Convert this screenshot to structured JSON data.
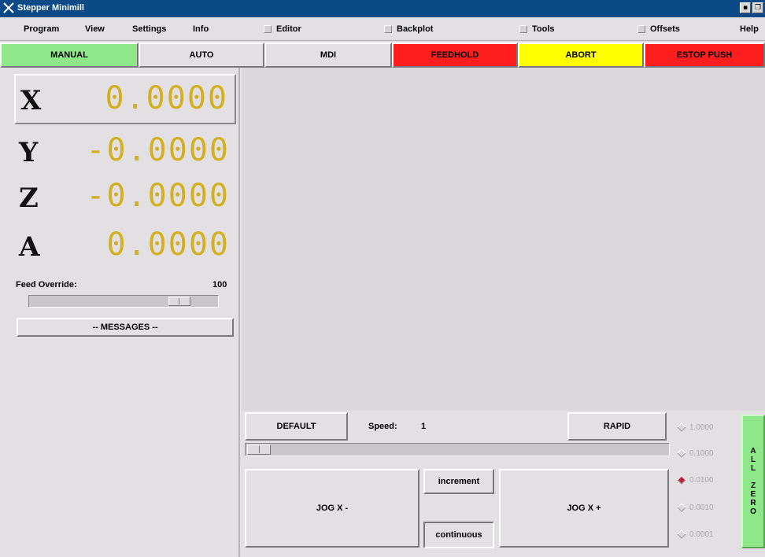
{
  "window": {
    "title": "Stepper Minimill"
  },
  "menu": {
    "items": [
      "Program",
      "View",
      "Settings",
      "Info"
    ],
    "toggles": [
      "Editor",
      "Backplot",
      "Tools",
      "Offsets"
    ],
    "help": "Help"
  },
  "modes": [
    {
      "label": "MANUAL",
      "color": "#8ee889"
    },
    {
      "label": "AUTO",
      "color": "#e3e0e4"
    },
    {
      "label": "MDI",
      "color": "#e3e0e4"
    },
    {
      "label": "FEEDHOLD",
      "color": "#ff1e1e"
    },
    {
      "label": "ABORT",
      "color": "#ffff00"
    },
    {
      "label": "ESTOP PUSH",
      "color": "#ff1e1e"
    }
  ],
  "axes": [
    {
      "letter": "X",
      "value": "0.0000"
    },
    {
      "letter": "Y",
      "value": "-0.0000"
    },
    {
      "letter": "Z",
      "value": "-0.0000"
    },
    {
      "letter": "A",
      "value": "0.0000"
    }
  ],
  "feed_override": {
    "label": "Feed Override:",
    "value": "100",
    "level_percent": 100
  },
  "messages_label": "-- MESSAGES --",
  "jog": {
    "default_label": "DEFAULT",
    "speed_label": "Speed:",
    "speed_value": "1",
    "rapid_label": "RAPID",
    "minus_label": "JOG X -",
    "plus_label": "JOG X +",
    "increment_label": "increment",
    "continuous_label": "continuous",
    "increments": [
      "1.0000",
      "0.1000",
      "0.0100",
      "0.0010",
      "0.0001"
    ],
    "selected_increment": "0.0100"
  },
  "all_zero_label": [
    "A",
    "L",
    "L",
    "",
    "Z",
    "E",
    "R",
    "O"
  ]
}
